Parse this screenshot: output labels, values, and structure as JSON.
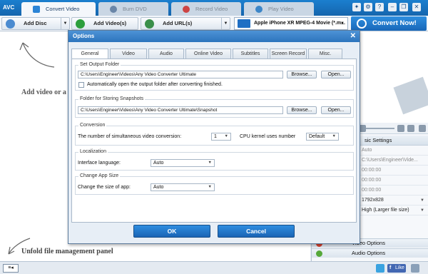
{
  "titlebar": {
    "logo": "AVC",
    "tabs": [
      {
        "label": "Convert Video",
        "icon": "convert-video-icon"
      },
      {
        "label": "Burn DVD",
        "icon": "disc-icon"
      },
      {
        "label": "Record Video",
        "icon": "record-icon"
      },
      {
        "label": "Play Video",
        "icon": "play-icon"
      }
    ],
    "window_buttons": [
      "gift-icon",
      "settings-icon",
      "help-icon",
      "minimize-icon",
      "restore-icon",
      "close-icon"
    ]
  },
  "toolbar": {
    "add_disc": "Add Disc",
    "add_videos": "Add Video(s)",
    "add_urls": "Add URL(s)",
    "profile": "Apple iPhone XR MPEG-4 Movie (*.m...",
    "convert_now": "Convert Now!"
  },
  "main": {
    "add_hint": "Add video or a",
    "unfold_hint": "Unfold file management panel"
  },
  "right_panel": {
    "section_title": "sic Settings",
    "rows": [
      {
        "value": "Auto",
        "style": "grey"
      },
      {
        "value": "C:\\Users\\Engineer\\Vide...",
        "style": "grey"
      },
      {
        "value": "00:00:00",
        "style": "grey"
      },
      {
        "value": "00:00:00",
        "style": "grey"
      },
      {
        "value": "00:00:00",
        "style": "grey"
      },
      {
        "value": "1792x828",
        "style": "select"
      },
      {
        "value": "High (Larger file size)",
        "style": "select"
      }
    ],
    "video_options": "Video Options",
    "audio_options": "Audio Options"
  },
  "statusbar": {
    "like": "Like"
  },
  "dialog": {
    "title": "Options",
    "tabs": [
      "General",
      "Video",
      "Audio",
      "Online Video",
      "Subtitles",
      "Screen Record",
      "Misc."
    ],
    "active_tab": "General",
    "output_group": {
      "title": "Set Output Folder",
      "path": "C:\\Users\\Engineer\\Videos\\Any Video Converter Ultimate",
      "browse": "Browse...",
      "open": "Open...",
      "auto_open": "Automatically open the output folder after converting finished.",
      "auto_open_checked": false
    },
    "snapshot_group": {
      "title": "Folder for Storing Snapshots",
      "path": "C:\\Users\\Engineer\\Videos\\Any Video Converter Ultimate\\Snapshot",
      "browse": "Browse...",
      "open": "Open..."
    },
    "conversion_group": {
      "title": "Conversion",
      "simultaneous_label": "The number of simultaneous video conversion:",
      "simultaneous_value": "1",
      "cpu_label": "CPU kernel uses number",
      "cpu_value": "Default"
    },
    "localization_group": {
      "title": "Localization",
      "language_label": "Interface language:",
      "language_value": "Auto"
    },
    "appsize_group": {
      "title": "Change App Size",
      "size_label": "Change the size of app:",
      "size_value": "Auto"
    },
    "ok": "OK",
    "cancel": "Cancel"
  },
  "colors": {
    "accent": "#1f74c6",
    "titlebar": "#1b7fcf"
  }
}
